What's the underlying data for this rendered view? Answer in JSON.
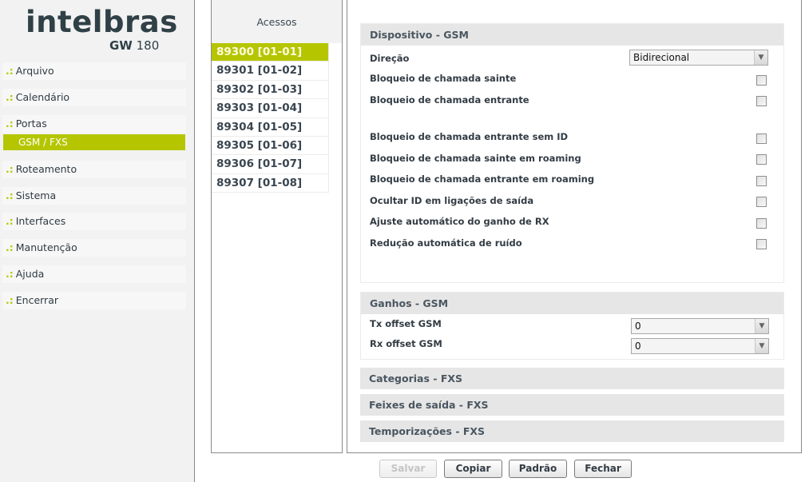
{
  "brand": {
    "logo_text": "intelbras",
    "model_prefix": "GW",
    "model_number": "180"
  },
  "sidebar": {
    "bullet": ".:",
    "items": [
      {
        "label": "Arquivo"
      },
      {
        "label": "Calendário"
      },
      {
        "label": "Portas",
        "submenu": [
          {
            "label": "GSM / FXS",
            "active": true
          }
        ]
      },
      {
        "label": "Roteamento"
      },
      {
        "label": "Sistema"
      },
      {
        "label": "Interfaces"
      },
      {
        "label": "Manutenção"
      },
      {
        "label": "Ajuda"
      },
      {
        "label": "Encerrar"
      }
    ]
  },
  "access": {
    "header": "Acessos",
    "items": [
      {
        "label": "89300 [01-01]",
        "active": true
      },
      {
        "label": "89301 [01-02]"
      },
      {
        "label": "89302 [01-03]"
      },
      {
        "label": "89303 [01-04]"
      },
      {
        "label": "89304 [01-05]"
      },
      {
        "label": "89305 [01-06]"
      },
      {
        "label": "89306 [01-07]"
      },
      {
        "label": "89307 [01-08]"
      }
    ]
  },
  "sections": {
    "device_gsm": {
      "title": "Dispositivo - GSM",
      "direction_label": "Direção",
      "direction_value": "Bidirecional",
      "checkboxes": [
        {
          "label": "Bloqueio de chamada sainte",
          "checked": false
        },
        {
          "label": "Bloqueio de chamada entrante",
          "checked": false
        },
        {
          "label": "Bloqueio de chamada entrante sem ID",
          "checked": false
        },
        {
          "label": "Bloqueio de chamada sainte em roaming",
          "checked": false
        },
        {
          "label": "Bloqueio de chamada entrante em roaming",
          "checked": false
        },
        {
          "label": "Ocultar ID em ligações de saída",
          "checked": false
        },
        {
          "label": "Ajuste automático do ganho de RX",
          "checked": false
        },
        {
          "label": "Redução automática de ruído",
          "checked": false
        }
      ]
    },
    "gains_gsm": {
      "title": "Ganhos - GSM",
      "tx_label": "Tx offset GSM",
      "tx_value": "0",
      "rx_label": "Rx offset GSM",
      "rx_value": "0"
    },
    "categories_fxs": {
      "title": "Categorias - FXS"
    },
    "outgoing_fxs": {
      "title": "Feixes de saída - FXS"
    },
    "timings_fxs": {
      "title": "Temporizações - FXS"
    }
  },
  "buttons": {
    "save": {
      "label": "Salvar",
      "disabled": true
    },
    "copy": {
      "label": "Copiar"
    },
    "default": {
      "label": "Padrão"
    },
    "close": {
      "label": "Fechar"
    }
  },
  "icons": {
    "dropdown_arrow": "chevron-down-icon"
  },
  "colors": {
    "accent": "#b5c600",
    "section_header_bg": "#e6e6e6",
    "sidebar_bg": "#f2f2f2",
    "text": "#333c44"
  }
}
